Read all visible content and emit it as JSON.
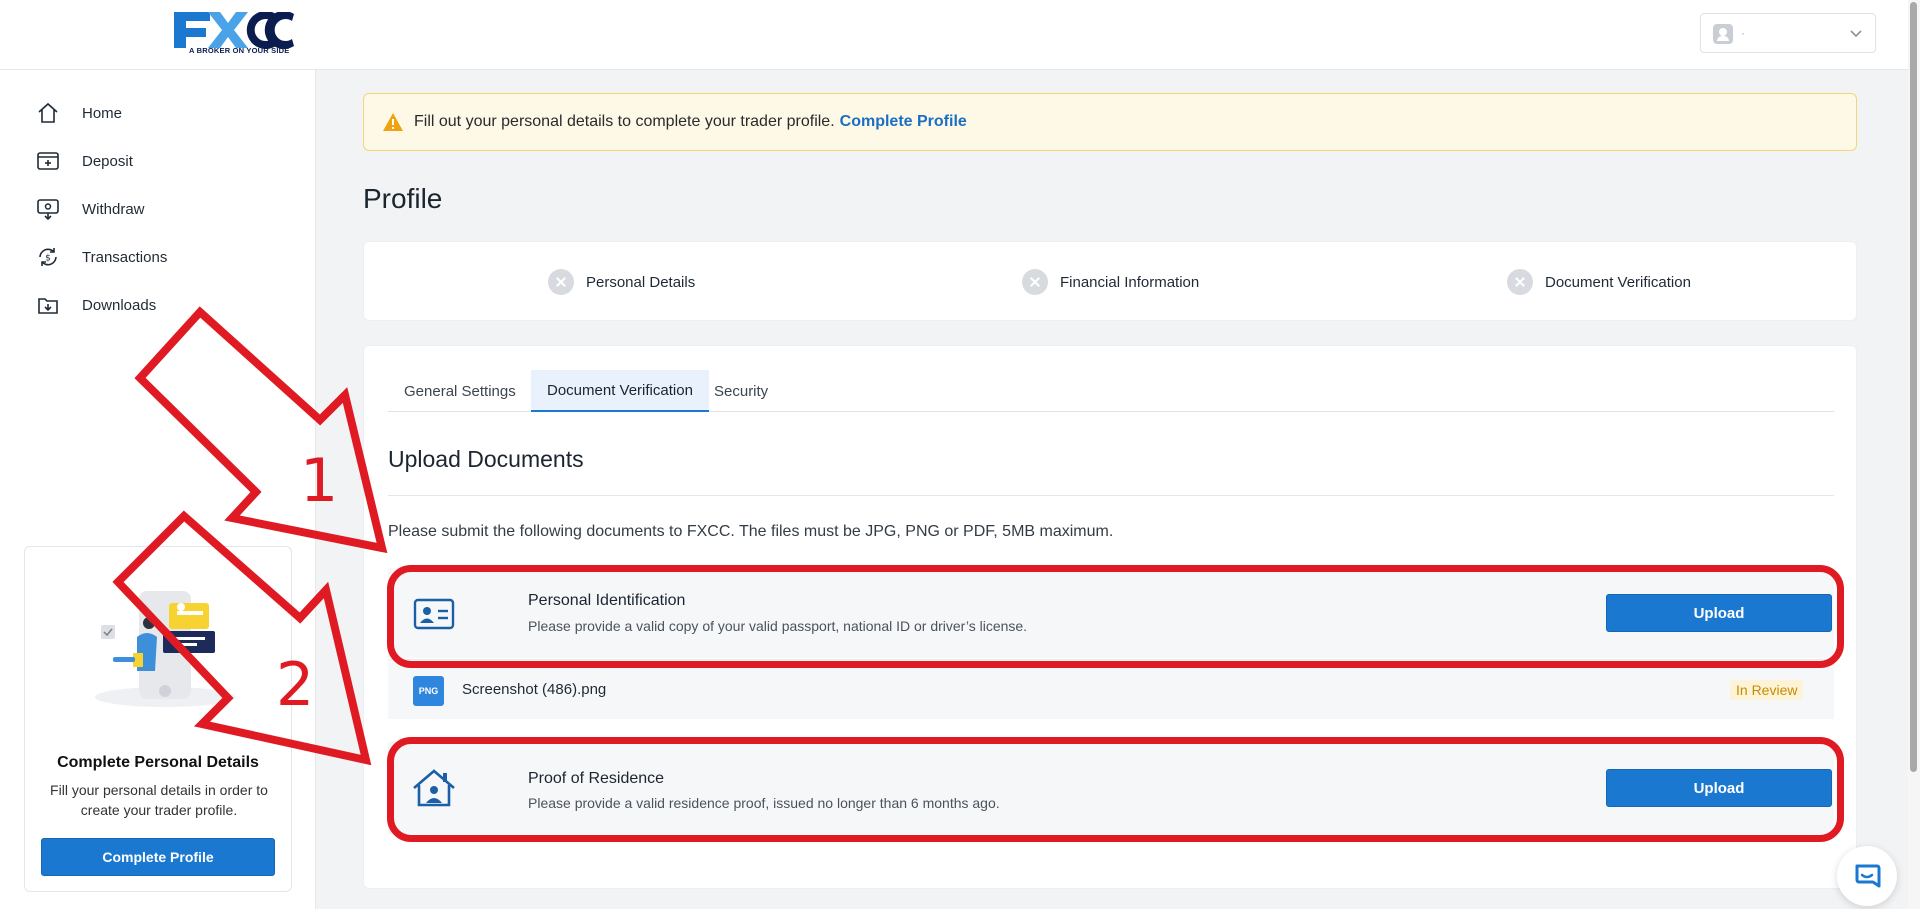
{
  "brand": {
    "logo_text": "FXCC",
    "tagline": "A BROKER ON YOUR SIDE",
    "colors": {
      "navy": "#0b1c4e",
      "blue": "#1a78d1",
      "light_blue": "#4aa3e6"
    }
  },
  "user_menu": {
    "name": "·",
    "icon": "user-avatar-icon"
  },
  "sidebar": {
    "items": [
      {
        "label": "Home",
        "icon": "home-icon"
      },
      {
        "label": "Deposit",
        "icon": "deposit-icon"
      },
      {
        "label": "Withdraw",
        "icon": "withdraw-icon"
      },
      {
        "label": "Transactions",
        "icon": "transactions-icon"
      },
      {
        "label": "Downloads",
        "icon": "downloads-icon"
      }
    ],
    "promo": {
      "title": "Complete Personal Details",
      "description": "Fill your personal details in order to create your trader profile.",
      "button": "Complete Profile"
    }
  },
  "alert": {
    "text": "Fill out your personal details to complete your trader profile.",
    "link": "Complete Profile",
    "icon": "warning-icon"
  },
  "page": {
    "title": "Profile"
  },
  "steps": [
    {
      "label": "Personal Details",
      "status": "incomplete"
    },
    {
      "label": "Financial Information",
      "status": "incomplete"
    },
    {
      "label": "Document Verification",
      "status": "incomplete"
    }
  ],
  "tabs": [
    {
      "label": "General Settings",
      "active": false
    },
    {
      "label": "Document Verification",
      "active": true
    },
    {
      "label": "Security",
      "active": false
    }
  ],
  "upload": {
    "title": "Upload Documents",
    "intro": "Please submit the following documents to FXCC. The files must be JPG, PNG or PDF, 5MB maximum.",
    "documents": [
      {
        "title": "Personal Identification",
        "description": "Please provide a valid copy of your valid passport, national ID or driver’s license.",
        "button": "Upload",
        "icon": "id-card-icon"
      },
      {
        "title": "Proof of Residence",
        "description": "Please provide a valid residence proof, issued no longer than 6 months ago.",
        "button": "Upload",
        "icon": "house-icon"
      }
    ],
    "file": {
      "type": "PNG",
      "name": "Screenshot (486).png",
      "status": "In Review"
    }
  },
  "annotations": {
    "one": "1",
    "two": "2",
    "color": "#e01a22"
  },
  "chat": {
    "icon": "chat-bubble-icon"
  }
}
